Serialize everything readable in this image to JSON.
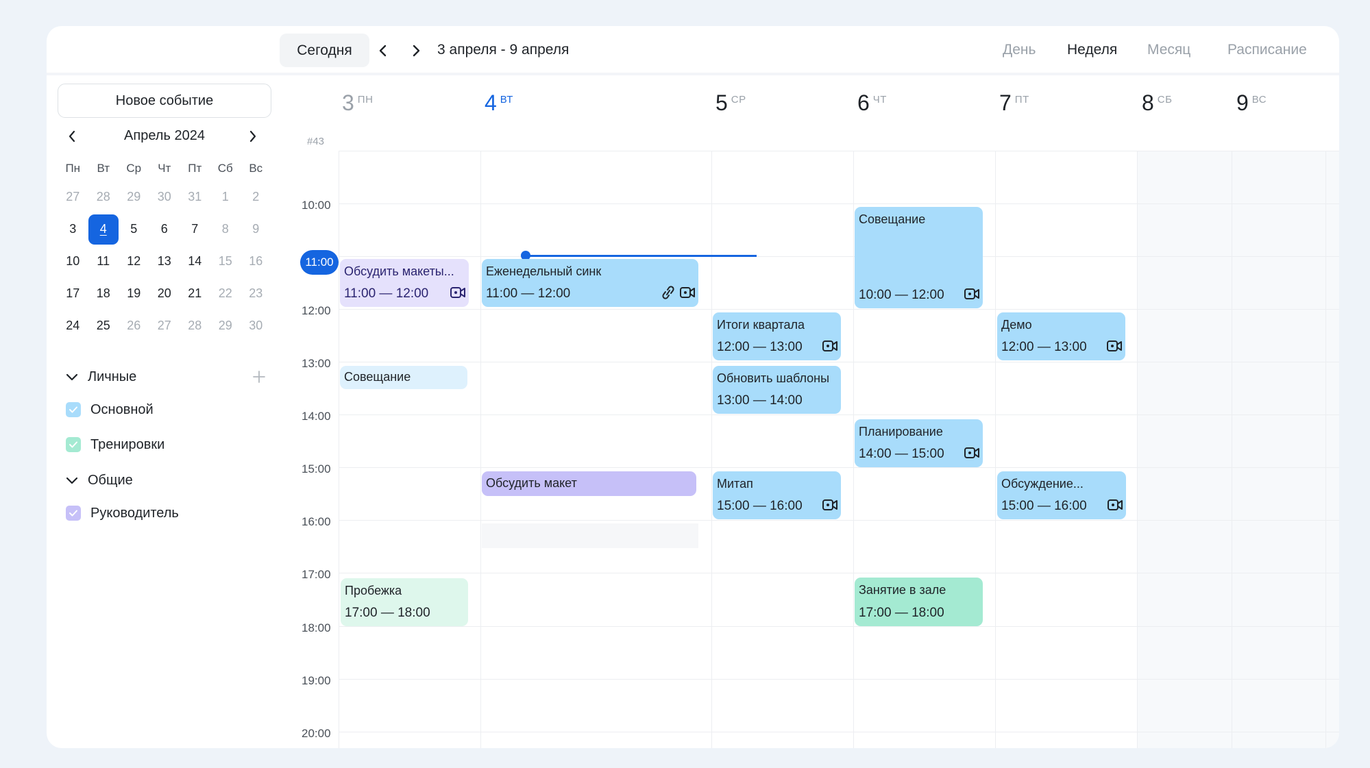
{
  "header": {
    "today_label": "Сегодня",
    "range_label": "3 апреля - 9 апреля",
    "views": [
      "День",
      "Неделя",
      "Месяц",
      "Расписание"
    ],
    "active_view": "Неделя"
  },
  "sidebar": {
    "new_event_label": "Новое событие",
    "month_label": "Апрель 2024",
    "weekday_labels": [
      "Пн",
      "Вт",
      "Ср",
      "Чт",
      "Пт",
      "Сб",
      "Вс"
    ],
    "weeks": [
      [
        "27",
        "28",
        "29",
        "30",
        "31",
        "1",
        "2"
      ],
      [
        "3",
        "4",
        "5",
        "6",
        "7",
        "8",
        "9"
      ],
      [
        "10",
        "11",
        "12",
        "13",
        "14",
        "15",
        "16"
      ],
      [
        "17",
        "18",
        "19",
        "20",
        "21",
        "22",
        "23"
      ],
      [
        "24",
        "25",
        "26",
        "27",
        "28",
        "29",
        "30"
      ]
    ],
    "selected_day": "4",
    "groups": [
      {
        "label": "Личные",
        "calendars": [
          {
            "label": "Основной",
            "color": "#a8dcfb"
          },
          {
            "label": "Тренировки",
            "color": "#a4ead2"
          }
        ]
      },
      {
        "label": "Общие",
        "calendars": [
          {
            "label": "Руководитель",
            "color": "#c6c0f8"
          }
        ]
      }
    ]
  },
  "week": {
    "week_number": "#43",
    "days": [
      {
        "num": "3",
        "abbr": "ПН"
      },
      {
        "num": "4",
        "abbr": "ВТ"
      },
      {
        "num": "5",
        "abbr": "СР"
      },
      {
        "num": "6",
        "abbr": "ЧТ"
      },
      {
        "num": "7",
        "abbr": "ПТ"
      },
      {
        "num": "8",
        "abbr": "СБ"
      },
      {
        "num": "9",
        "abbr": "ВС"
      }
    ],
    "hours": [
      "10:00",
      "11:00",
      "12:00",
      "13:00",
      "14:00",
      "15:00",
      "16:00",
      "17:00",
      "18:00",
      "19:00",
      "20:00"
    ],
    "current_time": "11:00"
  },
  "events": [
    {
      "title": "Обсудить макеты...",
      "time": "11:00 — 12:00",
      "day": "3",
      "icons": [
        "video-icon"
      ],
      "color": "#e5e1fc"
    },
    {
      "title": "Совещание",
      "time": "",
      "day": "3",
      "icons": [],
      "color": "#def1fd"
    },
    {
      "title": "Пробежка",
      "time": "17:00 — 18:00",
      "day": "3",
      "icons": [],
      "color": "#def7ec"
    },
    {
      "title": "Еженедельный синк",
      "time": "11:00 — 12:00",
      "day": "4",
      "icons": [
        "link-icon",
        "video-icon"
      ],
      "color": "#a8dcfb"
    },
    {
      "title": "Обсудить макет",
      "time": "",
      "day": "4",
      "icons": [],
      "color": "#c6c0f8"
    },
    {
      "title": "Итоги квартала",
      "time": "12:00 — 13:00",
      "day": "5",
      "icons": [
        "video-icon"
      ],
      "color": "#a8dcfb"
    },
    {
      "title": "Обновить шаблоны",
      "time": "13:00 — 14:00",
      "day": "5",
      "icons": [],
      "color": "#a8dcfb"
    },
    {
      "title": "Митап",
      "time": "15:00 — 16:00",
      "day": "5",
      "icons": [
        "video-icon"
      ],
      "color": "#a8dcfb"
    },
    {
      "title": "Совещание",
      "time": "10:00 — 12:00",
      "day": "6",
      "icons": [
        "video-icon"
      ],
      "color": "#a8dcfb"
    },
    {
      "title": "Планирование",
      "time": "14:00 — 15:00",
      "day": "6",
      "icons": [
        "video-icon"
      ],
      "color": "#a8dcfb"
    },
    {
      "title": "Занятие в зале",
      "time": "17:00 — 18:00",
      "day": "6",
      "icons": [],
      "color": "#a4ead2"
    },
    {
      "title": "Демо",
      "time": "12:00 — 13:00",
      "day": "7",
      "icons": [
        "video-icon"
      ],
      "color": "#a8dcfb"
    },
    {
      "title": "Обсуждение...",
      "time": "15:00 — 16:00",
      "day": "7",
      "icons": [
        "video-icon"
      ],
      "color": "#a8dcfb"
    }
  ]
}
